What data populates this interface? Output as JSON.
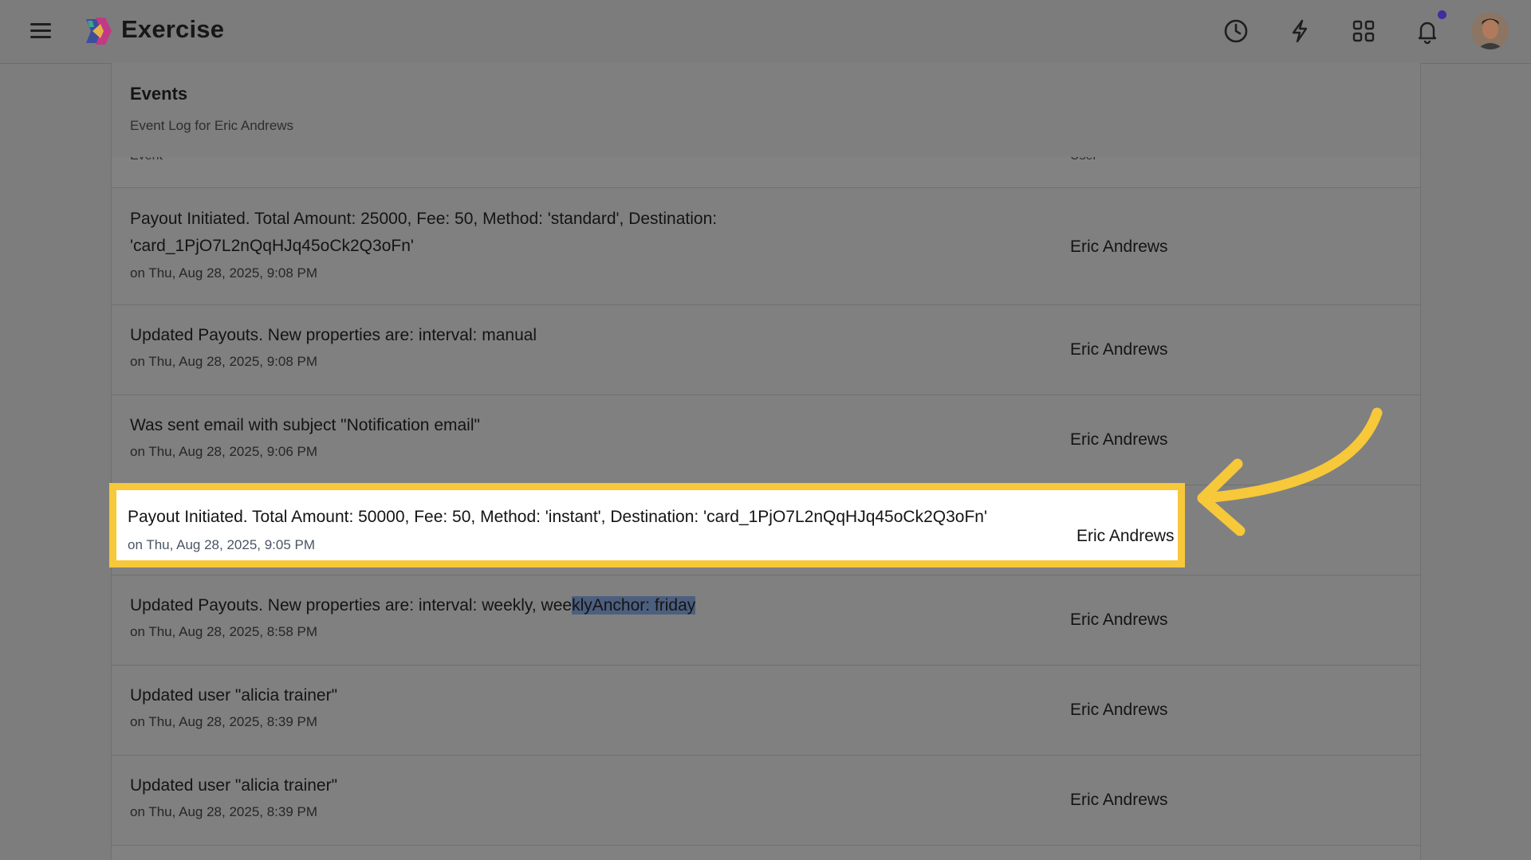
{
  "app": {
    "title": "Exercise"
  },
  "topbar": {
    "icons": [
      "menu-icon",
      "history-icon",
      "lightning-icon",
      "apps-grid-icon",
      "bell-icon"
    ],
    "accent": "#3c2f9e"
  },
  "panel": {
    "title": "Events",
    "subtitle": "Event Log for Eric Andrews",
    "columns": {
      "event": "Event",
      "user": "User"
    }
  },
  "events": [
    {
      "line1": "Payout Initiated. Total Amount: 25000, Fee: 50, Method: 'standard', Destination:",
      "line2": "'card_1PjO7L2nQqHJq45oCk2Q3oFn'",
      "date": "on Thu, Aug 28, 2025, 9:08 PM",
      "user": "Eric Andrews"
    },
    {
      "text": "Updated Payouts. New properties are: interval: manual",
      "date": "on Thu, Aug 28, 2025, 9:08 PM",
      "user": "Eric Andrews"
    },
    {
      "text": "Was sent email with subject \"Notification email\"",
      "date": "on Thu, Aug 28, 2025, 9:06 PM",
      "user": "Eric Andrews"
    },
    {
      "text": "Payout Initiated. Total Amount: 50000, Fee: 50, Method: 'instant', Destination: 'card_1PjO7L2nQqHJq45oCk2Q3oFn'",
      "date": "on Thu, Aug 28, 2025, 9:05 PM",
      "user": "Eric Andrews",
      "highlighted": true
    },
    {
      "text_pre": "Updated Payouts. New properties are: interval: weekly, wee",
      "text_sel": "klyAnchor: friday",
      "date": "on Thu, Aug 28, 2025, 8:58 PM",
      "user": "Eric Andrews"
    },
    {
      "text": "Updated user \"alicia trainer\"",
      "date": "on Thu, Aug 28, 2025, 8:39 PM",
      "user": "Eric Andrews"
    },
    {
      "text": "Updated user \"alicia trainer\"",
      "date": "on Thu, Aug 28, 2025, 8:39 PM",
      "user": "Eric Andrews"
    }
  ],
  "annotation": {
    "highlight_color": "#f6c83a",
    "arrow_icon": "curved-arrow-icon"
  }
}
